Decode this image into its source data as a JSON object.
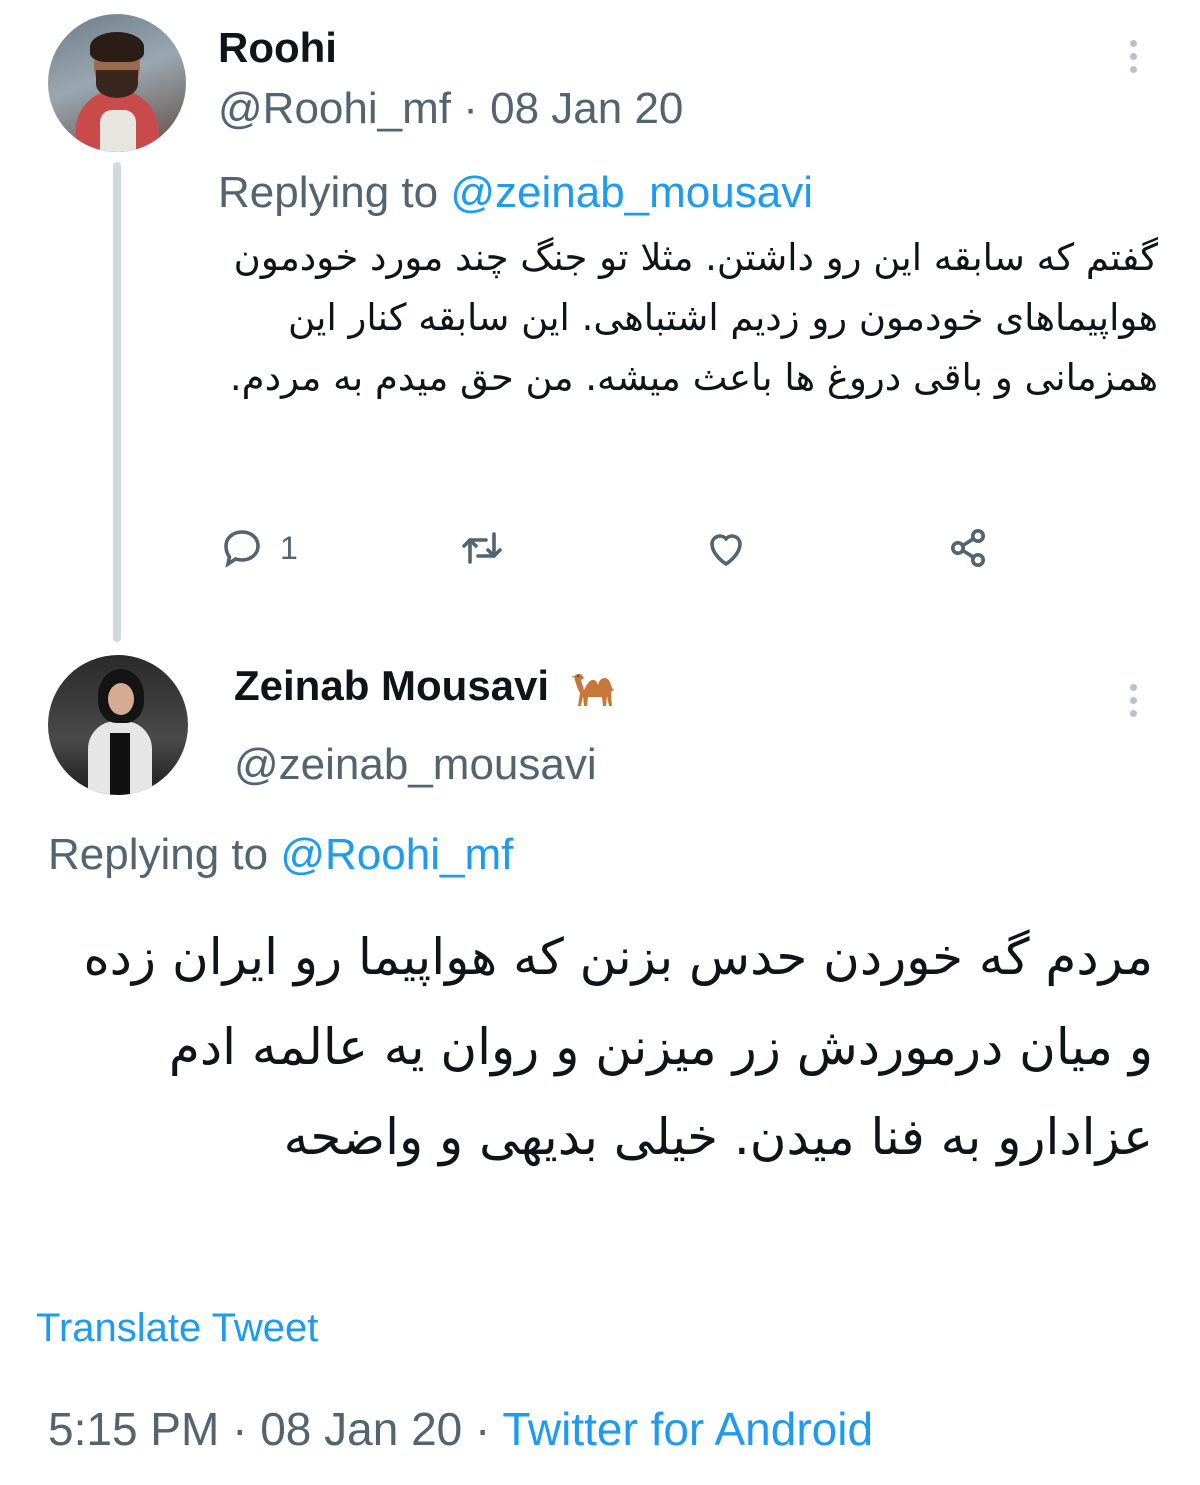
{
  "tweet1": {
    "name": "Roohi",
    "handle": "@Roohi_mf",
    "separator": "·",
    "date": "08 Jan 20",
    "replying_prefix": "Replying to ",
    "replying_handle": "@zeinab_mousavi",
    "text": "گفتم که سابقه این رو داشتن. مثلا تو جنگ چند مورد خودمون هواپیماهای خودمون رو زدیم اشتباهی. این سابقه کنار این همزمانی و باقی دروغ ها باعث میشه. من حق میدم به مردم.",
    "reply_count": "1",
    "icons": [
      "reply-icon",
      "retweet-icon",
      "like-icon",
      "share-icon",
      "more-icon"
    ]
  },
  "tweet2": {
    "name": "Zeinab Mousavi",
    "name_emoji_icon": "camel-icon",
    "handle": "@zeinab_mousavi",
    "replying_prefix": "Replying to ",
    "replying_handle": "@Roohi_mf",
    "text": "مردم گه خوردن حدس بزنن که هواپیما رو ایران زده و میان درموردش زر میزنن و روان یه عالمه ادم عزادارو به فنا میدن. خیلی بدیهی و واضحه",
    "translate_label": "Translate Tweet",
    "time": "5:15 PM",
    "separator1": " · ",
    "date": "08 Jan 20",
    "separator2": " · ",
    "source": "Twitter for Android"
  },
  "colors": {
    "link": "#1d9bf0",
    "secondary_text": "#536471",
    "primary_text": "#0f1419",
    "thread_line": "#cfd9de"
  }
}
